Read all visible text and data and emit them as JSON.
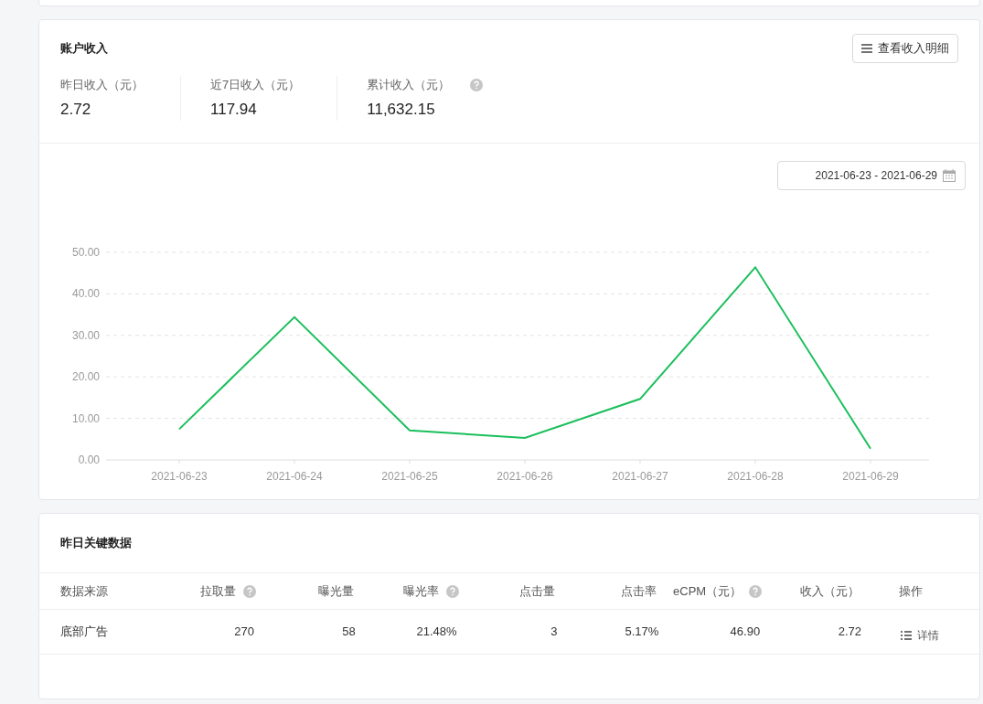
{
  "income_card": {
    "title": "账户收入",
    "detail_button": "查看收入明细",
    "stats": [
      {
        "label": "昨日收入（元）",
        "value": "2.72",
        "help": false
      },
      {
        "label": "近7日收入（元）",
        "value": "117.94",
        "help": false
      },
      {
        "label": "累计收入（元）",
        "value": "11,632.15",
        "help": true
      }
    ],
    "date_range": "2021-06-23 - 2021-06-29",
    "chart_data": {
      "type": "line",
      "categories": [
        "2021-06-23",
        "2021-06-24",
        "2021-06-25",
        "2021-06-26",
        "2021-06-27",
        "2021-06-28",
        "2021-06-29"
      ],
      "series": [
        {
          "color": "#1bbf5c",
          "values": [
            7.4,
            34.4,
            7.1,
            5.3,
            14.7,
            46.4,
            2.7
          ]
        }
      ],
      "grid": true,
      "ylim": [
        0,
        50
      ],
      "yticks": [
        {
          "value": 0,
          "label": "0.00"
        },
        {
          "value": 10,
          "label": "10.00"
        },
        {
          "value": 20,
          "label": "20.00"
        },
        {
          "value": 30,
          "label": "30.00"
        },
        {
          "value": 40,
          "label": "40.00"
        },
        {
          "value": 50,
          "label": "50.00"
        }
      ]
    }
  },
  "key_data": {
    "title": "昨日关键数据",
    "columns": [
      {
        "label": "数据来源",
        "help": false
      },
      {
        "label": "拉取量",
        "help": true
      },
      {
        "label": "曝光量",
        "help": false
      },
      {
        "label": "曝光率",
        "help": true
      },
      {
        "label": "点击量",
        "help": false
      },
      {
        "label": "点击率",
        "help": false
      },
      {
        "label": "eCPM（元）",
        "help": true
      },
      {
        "label": "收入（元）",
        "help": false
      },
      {
        "label": "操作",
        "help": false
      }
    ],
    "rows": [
      {
        "cells": [
          "底部广告",
          "270",
          "58",
          "21.48%",
          "3",
          "5.17%",
          "46.90",
          "2.72"
        ],
        "action": "详情"
      }
    ]
  }
}
